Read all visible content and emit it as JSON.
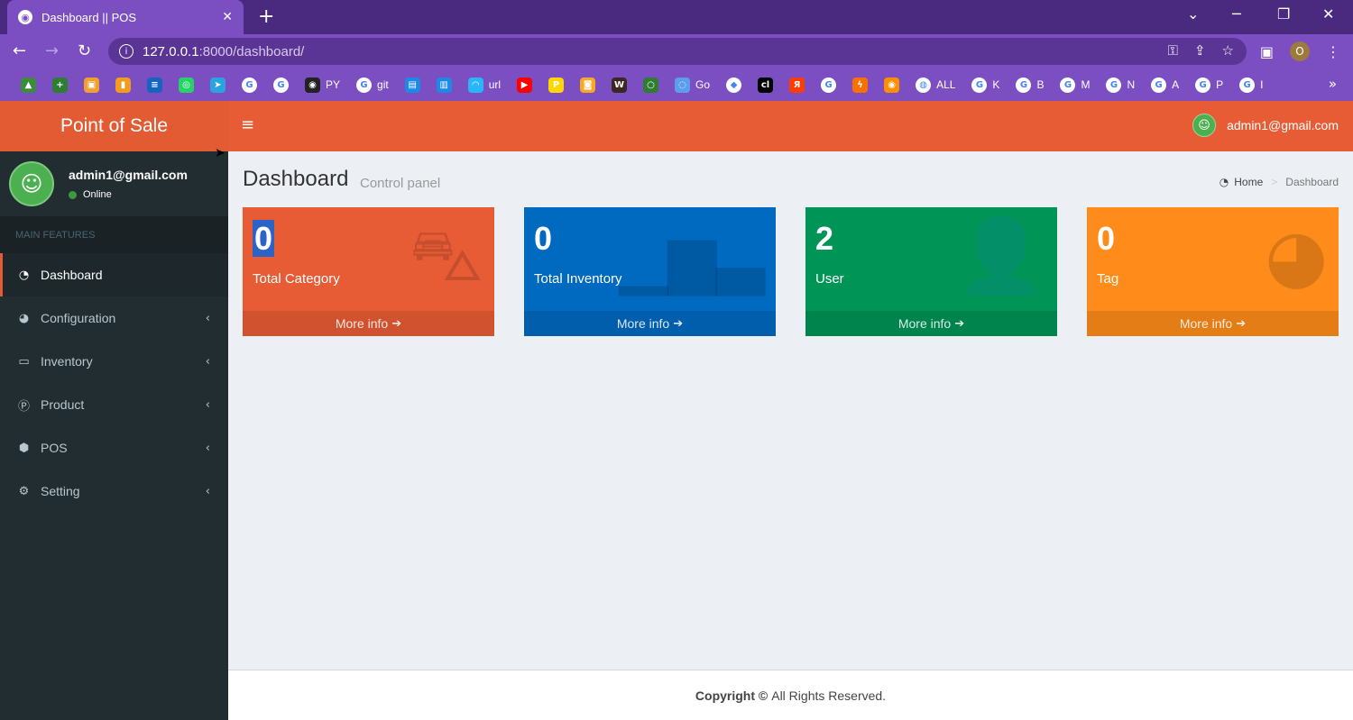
{
  "browser": {
    "tab_title": "Dashboard || POS",
    "url_host": "127.0.0.1",
    "url_path": ":8000/dashboard/",
    "profile_initial": "O",
    "bookmarks": [
      {
        "icon": "drive",
        "text": "",
        "color": "#3b8d3b"
      },
      {
        "icon": "plus",
        "text": "",
        "color": "#2e7d32"
      },
      {
        "icon": "box",
        "text": "",
        "color": "#f0a030"
      },
      {
        "icon": "chart",
        "text": "",
        "color": "#f29b1c"
      },
      {
        "icon": "ieee",
        "text": "",
        "color": "#1565c0"
      },
      {
        "icon": "whatsapp",
        "text": "",
        "color": "#25d366"
      },
      {
        "icon": "telegram",
        "text": "",
        "color": "#2aa3e0"
      },
      {
        "icon": "google",
        "text": "",
        "color": "#ffffff"
      },
      {
        "icon": "google",
        "text": "",
        "color": "#ffffff"
      },
      {
        "icon": "github",
        "text": "PY",
        "color": "#222222"
      },
      {
        "icon": "google",
        "text": "git",
        "color": "#ffffff"
      },
      {
        "icon": "image",
        "text": "",
        "color": "#1e88e5"
      },
      {
        "icon": "store",
        "text": "",
        "color": "#1e88e5"
      },
      {
        "icon": "wifi",
        "text": "url",
        "color": "#29b6f6"
      },
      {
        "icon": "youtube",
        "text": "",
        "color": "#ff0000"
      },
      {
        "icon": "p",
        "text": "",
        "color": "#ffd600"
      },
      {
        "icon": "cam",
        "text": "",
        "color": "#f9a825"
      },
      {
        "icon": "w",
        "text": "",
        "color": "#3e2723"
      },
      {
        "icon": "ring",
        "text": "",
        "color": "#2e7d32"
      },
      {
        "icon": "swirl",
        "text": "Go",
        "color": "#5c9ded"
      },
      {
        "icon": "gem",
        "text": "",
        "color": "#ffffff"
      },
      {
        "icon": "cl",
        "text": "",
        "color": "#000000"
      },
      {
        "icon": "ya",
        "text": "",
        "color": "#ff3d00"
      },
      {
        "icon": "google",
        "text": "",
        "color": "#ffffff"
      },
      {
        "icon": "bolt",
        "text": "",
        "color": "#ff6f00"
      },
      {
        "icon": "eye",
        "text": "",
        "color": "#ff8f00"
      },
      {
        "icon": "globe",
        "text": "ALL",
        "color": "#ffffff"
      },
      {
        "icon": "google",
        "text": "K",
        "color": "#ffffff"
      },
      {
        "icon": "google",
        "text": "B",
        "color": "#ffffff"
      },
      {
        "icon": "google",
        "text": "M",
        "color": "#ffffff"
      },
      {
        "icon": "google",
        "text": "N",
        "color": "#ffffff"
      },
      {
        "icon": "google",
        "text": "A",
        "color": "#ffffff"
      },
      {
        "icon": "google",
        "text": "P",
        "color": "#ffffff"
      },
      {
        "icon": "google",
        "text": "I",
        "color": "#ffffff"
      }
    ]
  },
  "app": {
    "logo": "Point of Sale",
    "user": {
      "email": "admin1@gmail.com",
      "status": "Online"
    },
    "menu_header": "MAIN FEATURES",
    "menu": [
      {
        "label": "Dashboard",
        "icon": "dashboard-icon",
        "active": true
      },
      {
        "label": "Configuration",
        "icon": "pie-chart-icon",
        "caret": true
      },
      {
        "label": "Inventory",
        "icon": "laptop-icon",
        "caret": true
      },
      {
        "label": "Product",
        "icon": "product-p-icon",
        "caret": true
      },
      {
        "label": "POS",
        "icon": "cube-icon",
        "caret": true
      },
      {
        "label": "Setting",
        "icon": "gears-icon",
        "caret": true
      }
    ],
    "top_user_email": "admin1@gmail.com"
  },
  "page": {
    "title": "Dashboard",
    "subtitle": "Control panel",
    "breadcrumb": {
      "home": "Home",
      "current": "Dashboard"
    }
  },
  "boxes": [
    {
      "count": "0",
      "label": "Total Category",
      "icon": "shopping-bag-icon",
      "color": "#e85c35",
      "footer": "More info"
    },
    {
      "count": "0",
      "label": "Total Inventory",
      "icon": "bar-chart-icon",
      "color": "#0069c0",
      "footer": "More info"
    },
    {
      "count": "2",
      "label": "User",
      "icon": "user-add-icon",
      "color": "#009456",
      "footer": "More info"
    },
    {
      "count": "0",
      "label": "Tag",
      "icon": "pie-chart-icon",
      "color": "#ff8c1a",
      "footer": "More info"
    }
  ],
  "footer": {
    "copyright_bold": "Copyright ©",
    "copyright_text": "All Rights Reserved."
  }
}
